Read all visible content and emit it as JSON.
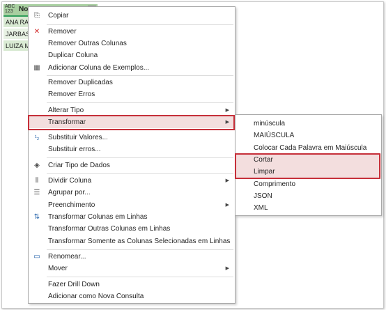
{
  "grid": {
    "column_type": "ABC\n123",
    "column_name": "Nome",
    "dropdown_glyph": "▾",
    "cells": [
      "ANA RAC",
      "JARBAS I",
      "LUIZA M"
    ]
  },
  "menu": {
    "items": [
      {
        "label": "Copiar",
        "icon": "copy-icon",
        "glyph": "⎘"
      },
      {
        "label": "Remover",
        "icon": "remove-icon",
        "glyph": "✕"
      },
      {
        "label": "Remover Outras Colunas",
        "icon": "",
        "glyph": ""
      },
      {
        "label": "Duplicar Coluna",
        "icon": "",
        "glyph": ""
      },
      {
        "label": "Adicionar Coluna de Exemplos...",
        "icon": "column-from-examples-icon",
        "glyph": "▦"
      },
      {
        "label": "Remover Duplicadas",
        "icon": "",
        "glyph": ""
      },
      {
        "label": "Remover Erros",
        "icon": "",
        "glyph": ""
      },
      {
        "label": "Alterar Tipo",
        "icon": "",
        "glyph": "",
        "arrow": "▶"
      },
      {
        "label": "Transformar",
        "icon": "",
        "glyph": "",
        "arrow": "▶"
      },
      {
        "label": "Substituir Valores...",
        "icon": "replace-values-icon",
        "glyph": "¹₂"
      },
      {
        "label": "Substituir erros...",
        "icon": "",
        "glyph": ""
      },
      {
        "label": "Criar Tipo de Dados",
        "icon": "data-type-icon",
        "glyph": "◈"
      },
      {
        "label": "Dividir Coluna",
        "icon": "split-column-icon",
        "glyph": "⫴",
        "arrow": "▶"
      },
      {
        "label": "Agrupar por...",
        "icon": "group-by-icon",
        "glyph": "☰"
      },
      {
        "label": "Preenchimento",
        "icon": "",
        "glyph": "",
        "arrow": "▶"
      },
      {
        "label": "Transformar Colunas em Linhas",
        "icon": "unpivot-icon",
        "glyph": "⇅"
      },
      {
        "label": "Transformar Outras Colunas em Linhas",
        "icon": "",
        "glyph": ""
      },
      {
        "label": "Transformar Somente as Colunas Selecionadas em Linhas",
        "icon": "",
        "glyph": ""
      },
      {
        "label": "Renomear...",
        "icon": "rename-icon",
        "glyph": "▭"
      },
      {
        "label": "Mover",
        "icon": "",
        "glyph": "",
        "arrow": "▶"
      },
      {
        "label": "Fazer Drill Down",
        "icon": "",
        "glyph": ""
      },
      {
        "label": "Adicionar como Nova Consulta",
        "icon": "",
        "glyph": ""
      }
    ]
  },
  "submenu": {
    "items": [
      {
        "label": "minúscula"
      },
      {
        "label": "MAIÚSCULA"
      },
      {
        "label": "Colocar Cada Palavra em Maiúscula"
      },
      {
        "label": "Cortar"
      },
      {
        "label": "Limpar"
      },
      {
        "label": "Comprimento"
      },
      {
        "label": "JSON"
      },
      {
        "label": "XML"
      }
    ]
  },
  "colors": {
    "highlight_border": "#c6303a",
    "highlight_fill": "#f3dede",
    "column_header": "#a8cfa0",
    "column_underline": "#2f9e5a"
  }
}
